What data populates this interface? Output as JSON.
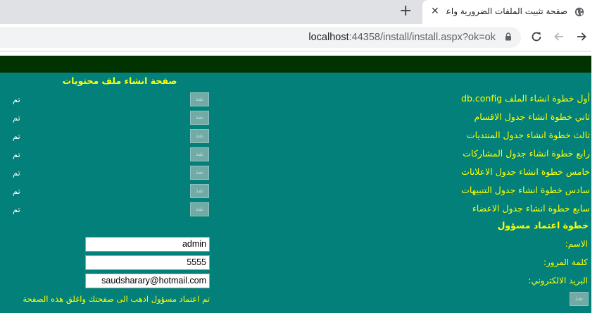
{
  "browser": {
    "tab_title": "صفحة تثبيت الملفات الضرورية واعداد",
    "url_host": "localhost",
    "url_rest": ":44358/install/install.aspx?ok=ok"
  },
  "page": {
    "heading": "صفحة انشاء ملف محتويات",
    "steps": [
      {
        "label": "أول خطوة انشاء الملف db.config",
        "button": "نفذ",
        "status": "تم"
      },
      {
        "label": "ثاني خطوة انشاء جدول الاقسام",
        "button": "نفذ",
        "status": "تم"
      },
      {
        "label": "ثالث خطوة انشاء جدول المنتديات",
        "button": "نفذ",
        "status": "تم"
      },
      {
        "label": "رابع خطوة انشاء جدول المشاركات",
        "button": "نفذ",
        "status": "تم"
      },
      {
        "label": "خامس خطوة انشاء جدول الاعلانات",
        "button": "نفذ",
        "status": "تم"
      },
      {
        "label": "سادس خطوة انشاء جدول التنبيهات",
        "button": "نفذ",
        "status": "تم"
      },
      {
        "label": "سابع خطوة انشاء جدول الاعضاء",
        "button": "نفذ",
        "status": "تم"
      }
    ],
    "admin_section_title": "خطوة اعتماد مسؤول",
    "name_label": "الاسم:",
    "name_value": "admin",
    "password_label": "كلمة المرور:",
    "password_value": "5555",
    "email_label": "البريد الالكتروني:",
    "email_value": "saudsharary@hotmail.com",
    "final_note": "تم اعتماد مسؤول اذهب الى صفحتك واغلق هذه الصفحة",
    "final_button": "نفذ"
  },
  "colors": {
    "page_bg": "#028079",
    "top_bar": "#003300",
    "label_text": "#ffff00"
  }
}
